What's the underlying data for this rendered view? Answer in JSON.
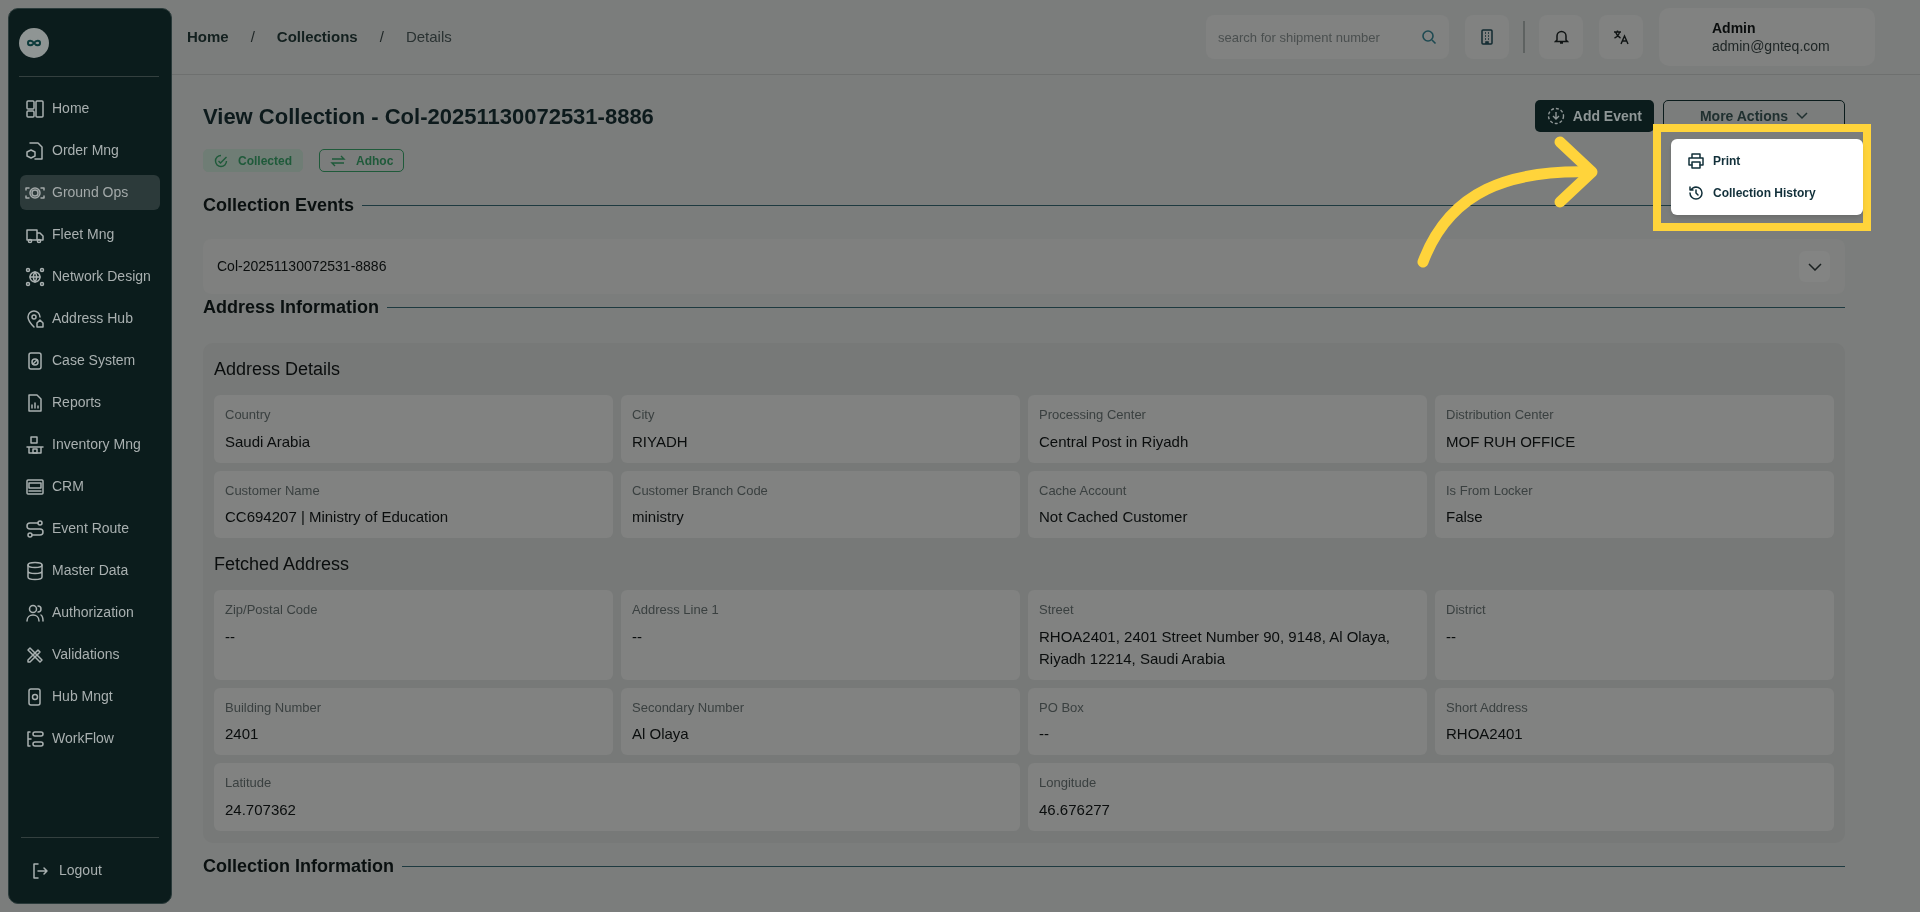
{
  "sidebar": {
    "items": [
      {
        "label": "Home",
        "selected": false
      },
      {
        "label": "Order Mng",
        "selected": false
      },
      {
        "label": "Ground Ops",
        "selected": true
      },
      {
        "label": "Fleet Mng",
        "selected": false
      },
      {
        "label": "Network Design",
        "selected": false
      },
      {
        "label": "Address Hub",
        "selected": false
      },
      {
        "label": "Case System",
        "selected": false
      },
      {
        "label": "Reports",
        "selected": false
      },
      {
        "label": "Inventory Mng",
        "selected": false
      },
      {
        "label": "CRM",
        "selected": false
      },
      {
        "label": "Event Route",
        "selected": false
      },
      {
        "label": "Master Data",
        "selected": false
      },
      {
        "label": "Authorization",
        "selected": false
      },
      {
        "label": "Validations",
        "selected": false
      },
      {
        "label": "Hub Mngt",
        "selected": false
      },
      {
        "label": "WorkFlow",
        "selected": false
      }
    ],
    "logout": "Logout"
  },
  "header": {
    "breadcrumb": [
      "Home",
      "Collections",
      "Details"
    ],
    "breadcrumb_separators": [
      "/",
      "/"
    ],
    "search": {
      "placeholder": "search for shipment number"
    },
    "user": {
      "name": "Admin",
      "email": "admin@gnteq.com"
    }
  },
  "page": {
    "title": "View Collection - Col-20251130072531-8886",
    "badges": [
      {
        "label": "Collected",
        "kind": "filled"
      },
      {
        "label": "Adhoc",
        "kind": "outline"
      }
    ],
    "actions": [
      {
        "label": "Add Event",
        "kind": "primary"
      },
      {
        "label": "More Actions",
        "kind": "dropdown"
      }
    ],
    "menu": [
      {
        "label": "Print"
      },
      {
        "label": "Collection History"
      }
    ],
    "collection_events": {
      "title": "Collection Events",
      "items": [
        {
          "label": "Col-20251130072531-8886",
          "expanded": false
        }
      ]
    },
    "address_information": {
      "title": "Address Information",
      "groups": [
        {
          "title": "Address Details",
          "fields": [
            {
              "label": "Country",
              "value": "Saudi Arabia"
            },
            {
              "label": "City",
              "value": "RIYADH"
            },
            {
              "label": "Processing Center",
              "value": "Central Post in Riyadh"
            },
            {
              "label": "Distribution Center",
              "value": "MOF RUH OFFICE"
            },
            {
              "label": "Customer Name",
              "value": "CC694207 | Ministry of Education"
            },
            {
              "label": "Customer Branch Code",
              "value": "ministry"
            },
            {
              "label": "Cache Account",
              "value": "Not Cached Customer"
            },
            {
              "label": "Is From Locker",
              "value": "False"
            }
          ]
        },
        {
          "title": "Fetched Address",
          "fields": [
            {
              "label": "Zip/Postal Code",
              "value": "--"
            },
            {
              "label": "Address Line 1",
              "value": "--"
            },
            {
              "label": "Street",
              "value": "RHOA2401, 2401 Street Number 90, 9148, Al Olaya, Riyadh 12214, Saudi Arabia"
            },
            {
              "label": "District",
              "value": "--"
            },
            {
              "label": "Building Number",
              "value": "2401"
            },
            {
              "label": "Secondary Number",
              "value": "Al Olaya"
            },
            {
              "label": "PO Box",
              "value": "--"
            },
            {
              "label": "Short Address",
              "value": "RHOA2401"
            },
            {
              "label": "Latitude",
              "value": "24.707362"
            },
            {
              "label": "Longitude",
              "value": "46.676277"
            }
          ]
        }
      ]
    },
    "collection_information": {
      "title": "Collection Information"
    }
  }
}
